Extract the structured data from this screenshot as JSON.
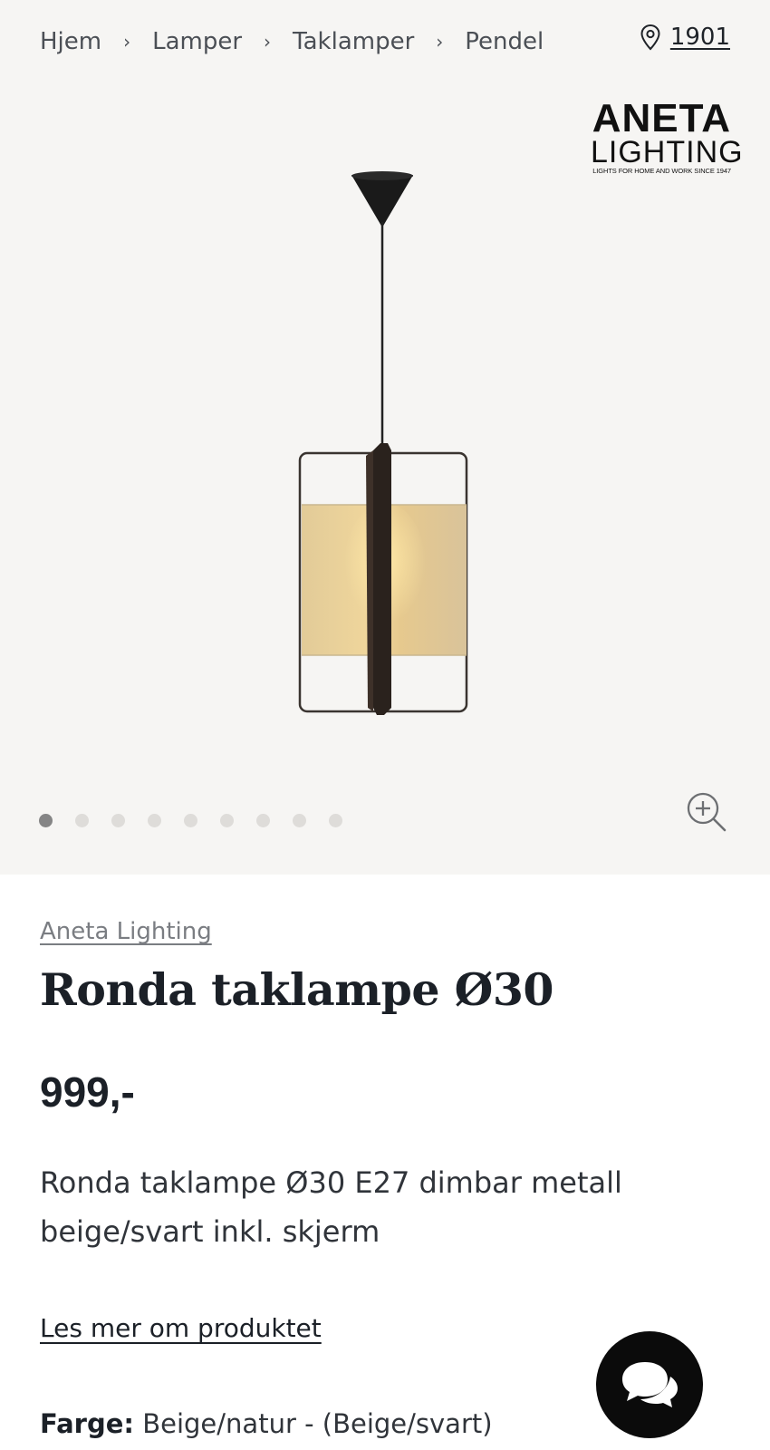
{
  "breadcrumb": {
    "items": [
      "Hjem",
      "Lamper",
      "Taklamper",
      "Pendel"
    ],
    "separator": "›"
  },
  "store": {
    "label": "1901",
    "icon": "location-pin-icon"
  },
  "logo": {
    "line1": "ANETA",
    "line2": "LIGHTING",
    "tagline": "LIGHTS FOR HOME AND WORK SINCE 1947"
  },
  "gallery": {
    "image_count": 9,
    "active_index": 0,
    "zoom_icon": "zoom-in-icon"
  },
  "product": {
    "brand": "Aneta Lighting",
    "title": "Ronda taklampe Ø30",
    "price": "999,-",
    "description": "Ronda taklampe Ø30 E27 dimbar metall beige/svart inkl. skjerm",
    "read_more": "Les mer om produktet",
    "color_label": "Farge:",
    "color_value": "Beige/natur - (Beige/svart)"
  },
  "chat": {
    "icon": "chat-bubbles-icon"
  },
  "colors": {
    "hero_bg": "#f6f5f3",
    "text": "#1b2027",
    "chat_bg": "#0b0b0b"
  }
}
